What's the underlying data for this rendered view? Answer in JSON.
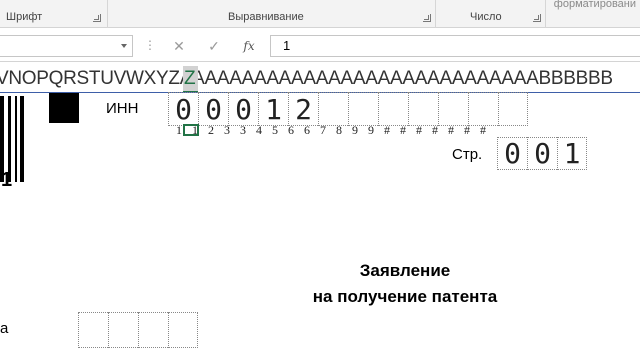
{
  "ribbon": {
    "groups": [
      {
        "label": "Шрифт"
      },
      {
        "label": "Выравнивание"
      },
      {
        "label": "Число"
      }
    ],
    "cut_label": "форматировани"
  },
  "formula_bar": {
    "name_box": "",
    "cancel_icon": "✕",
    "enter_icon": "✓",
    "fx_label": "fx",
    "value": "1"
  },
  "column_headers": {
    "letters": "VNOPQRSTUVWXYZAAAAAAAAAAAAAAAAAAAAAAAAAAAAABBBBBB",
    "selected": "Z"
  },
  "sheet": {
    "barcode_number": "1",
    "inn_label": "ИНН",
    "inn_digits": [
      "0",
      "0",
      "0",
      "1",
      "2",
      "",
      "",
      "",
      "",
      "",
      "",
      ""
    ],
    "index_numbers": [
      "1",
      "1",
      "2",
      "3",
      "3",
      "4",
      "5",
      "6",
      "6",
      "7",
      "8",
      "9",
      "9",
      "#",
      "#",
      "#",
      "#",
      "#",
      "#",
      "#"
    ],
    "page_label": "Стр.",
    "page_digits": [
      "0",
      "0",
      "1"
    ],
    "title_line1": "Заявление",
    "title_line2": "на получение патента",
    "left_letter": "а",
    "bottom_cells": [
      "",
      "",
      "",
      ""
    ]
  }
}
